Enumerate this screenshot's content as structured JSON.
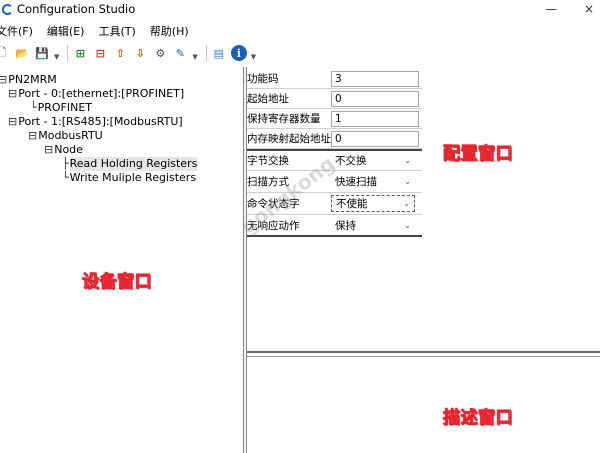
{
  "window": {
    "title": "Configuration Studio",
    "controls": [
      "—",
      "×"
    ]
  },
  "menu": [
    {
      "label": "文件(F)"
    },
    {
      "label": "编辑(E)"
    },
    {
      "label": "工具(T)"
    },
    {
      "label": "帮助(H)"
    }
  ],
  "toolbar": {
    "buttons": [
      {
        "icon": "new-file-icon",
        "glyph": "🗋"
      },
      {
        "icon": "open-folder-icon",
        "glyph": "📂"
      },
      {
        "icon": "save-icon",
        "glyph": "💾"
      },
      {
        "icon": "add-device-icon",
        "glyph": "⊞"
      },
      {
        "icon": "remove-device-icon",
        "glyph": "⊟"
      },
      {
        "icon": "upload-icon",
        "glyph": "⇧"
      },
      {
        "icon": "download-icon",
        "glyph": "⇩"
      },
      {
        "icon": "settings-icon",
        "glyph": "⚙"
      },
      {
        "icon": "edit-icon",
        "glyph": "✎"
      },
      {
        "icon": "monitor-icon",
        "glyph": "▤"
      },
      {
        "icon": "info-icon",
        "glyph": "i"
      }
    ]
  },
  "tree": {
    "items": [
      {
        "label": "PN2MRM",
        "prefix": "⊟"
      },
      {
        "label": "Port - 0:[ethernet]:[PROFINET]",
        "prefix": "⊟"
      },
      {
        "label": "PROFINET",
        "prefix": "└"
      },
      {
        "label": "Port - 1:[RS485]:[ModbusRTU]",
        "prefix": "⊟"
      },
      {
        "label": "ModbusRTU",
        "prefix": "⊟"
      },
      {
        "label": "Node",
        "prefix": "⊟"
      },
      {
        "label": "Read Holding Registers",
        "prefix": "├"
      },
      {
        "label": "Write Muliple Registers",
        "prefix": "└"
      }
    ]
  },
  "config": {
    "rows": [
      {
        "key": "功能码",
        "value": "3",
        "type": "text"
      },
      {
        "key": "起始地址",
        "value": "0",
        "type": "text"
      },
      {
        "key": "保持寄存器数量",
        "value": "1",
        "type": "text"
      },
      {
        "key": "内存映射起始地址",
        "value": "0",
        "type": "text"
      },
      {
        "key": "字节交换",
        "value": "不交换",
        "type": "select"
      },
      {
        "key": "扫描方式",
        "value": "快速扫描",
        "type": "select"
      },
      {
        "key": "命令状态字",
        "value": "不使能",
        "type": "select"
      },
      {
        "key": "无响应动作",
        "value": "保持",
        "type": "select"
      }
    ]
  },
  "annotations": {
    "device_window": "设备窗口",
    "config_window": "配置窗口",
    "description_window": "描述窗口",
    "color": "#e8242f"
  },
  "watermark": "gongkong"
}
